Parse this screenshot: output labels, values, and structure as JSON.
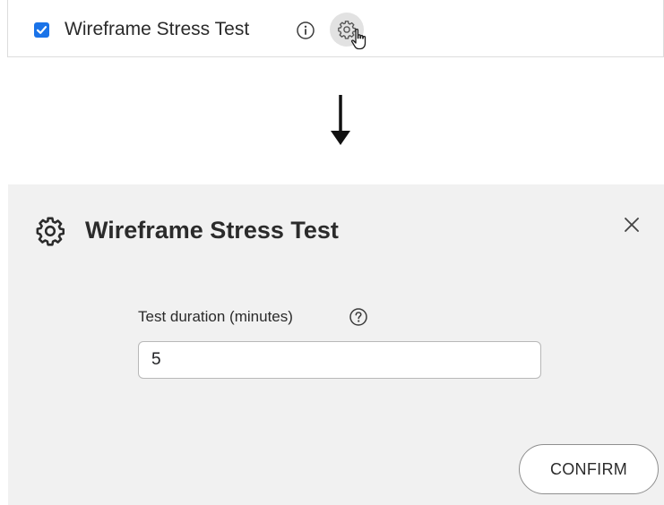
{
  "test_item": {
    "checked": true,
    "label": "Wireframe Stress Test",
    "icons": {
      "info": "info-icon",
      "settings": "gear-icon",
      "cursor": "hand-pointer-icon"
    }
  },
  "transition": {
    "icon": "arrow-down-icon"
  },
  "dialog": {
    "title": "Wireframe Stress Test",
    "title_icon": "gear-icon",
    "close_icon": "close-icon",
    "field": {
      "label": "Test duration (minutes)",
      "help_icon": "question-circle-icon",
      "value": "5"
    },
    "confirm_label": "CONFIRM"
  },
  "colors": {
    "checkbox": "#1a73e8",
    "dialog_background": "#f1f1f1",
    "gear_button_background": "#e2e2e2"
  }
}
